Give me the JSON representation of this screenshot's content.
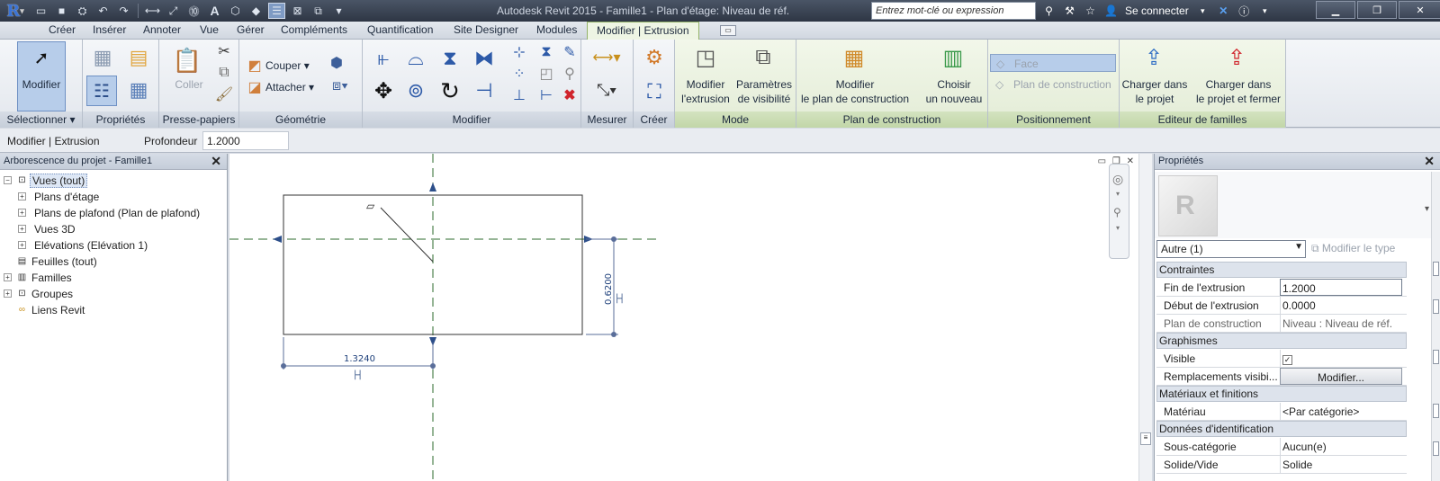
{
  "window": {
    "title": "Autodesk Revit 2015  -  Famille1 - Plan d'étage: Niveau de réf.",
    "search_placeholder": "Entrez mot-clé ou expression",
    "sign_in": "Se connecter",
    "app_letter": "R"
  },
  "tabs": [
    {
      "label": "Créer"
    },
    {
      "label": "Insérer"
    },
    {
      "label": "Annoter"
    },
    {
      "label": "Vue"
    },
    {
      "label": "Gérer"
    },
    {
      "label": "Compléments"
    },
    {
      "label": "Quantification"
    },
    {
      "label": "Site Designer"
    },
    {
      "label": "Modules"
    },
    {
      "label": "Modifier | Extrusion"
    }
  ],
  "ribbon": {
    "panels": {
      "select": "Sélectionner",
      "properties": "Propriétés",
      "clipboard": "Presse-papiers",
      "geometry": "Géométrie",
      "modify": "Modifier",
      "measure": "Mesurer",
      "create": "Créer",
      "mode": "Mode",
      "work_plane": "Plan de construction",
      "placement": "Positionnement",
      "family_editor": "Editeur de familles"
    },
    "buttons": {
      "modify": "Modifier",
      "paste": "Coller",
      "cut": "Couper",
      "join": "Attacher",
      "edit_extrusion_1": "Modifier",
      "edit_extrusion_2": "l'extrusion",
      "visibility_1": "Paramètres",
      "visibility_2": "de visibilité",
      "edit_workplane_1": "Modifier",
      "edit_workplane_2": "le plan de construction",
      "pick_new_1": "Choisir",
      "pick_new_2": "un nouveau",
      "face": "Face",
      "work_plane_opt": "Plan de construction",
      "load_project_1": "Charger dans",
      "load_project_2": "le projet",
      "load_close_1": "Charger dans",
      "load_close_2": "le projet et fermer"
    }
  },
  "options_bar": {
    "context": "Modifier | Extrusion",
    "depth_label": "Profondeur",
    "depth_value": "1.2000"
  },
  "project_browser": {
    "title": "Arborescence du projet - Famille1",
    "items": [
      {
        "label": "Vues (tout)"
      },
      {
        "label": "Plans d'étage"
      },
      {
        "label": "Plans de plafond (Plan de plafond)"
      },
      {
        "label": "Vues 3D"
      },
      {
        "label": "Elévations (Elévation 1)"
      },
      {
        "label": "Feuilles (tout)"
      },
      {
        "label": "Familles"
      },
      {
        "label": "Groupes"
      },
      {
        "label": "Liens Revit"
      }
    ]
  },
  "canvas": {
    "dim_horizontal": "1.3240",
    "dim_vertical": "0.6200"
  },
  "properties": {
    "title": "Propriétés",
    "type_selector": "Autre (1)",
    "edit_type": "Modifier le type",
    "groups": {
      "constraints": "Contraintes",
      "graphics": "Graphismes",
      "materials": "Matériaux et finitions",
      "identity": "Données d'identification"
    },
    "rows": {
      "extrusion_end": {
        "name": "Fin de l'extrusion",
        "value": "1.2000"
      },
      "extrusion_start": {
        "name": "Début de l'extrusion",
        "value": "0.0000"
      },
      "work_plane": {
        "name": "Plan de construction",
        "value": "Niveau : Niveau de réf."
      },
      "visible": {
        "name": "Visible"
      },
      "overrides": {
        "name": "Remplacements visibi...",
        "value": "Modifier..."
      },
      "material": {
        "name": "Matériau",
        "value": "<Par catégorie>"
      },
      "subcategory": {
        "name": "Sous-catégorie",
        "value": "Aucun(e)"
      },
      "solid_void": {
        "name": "Solide/Vide",
        "value": "Solide"
      }
    }
  }
}
